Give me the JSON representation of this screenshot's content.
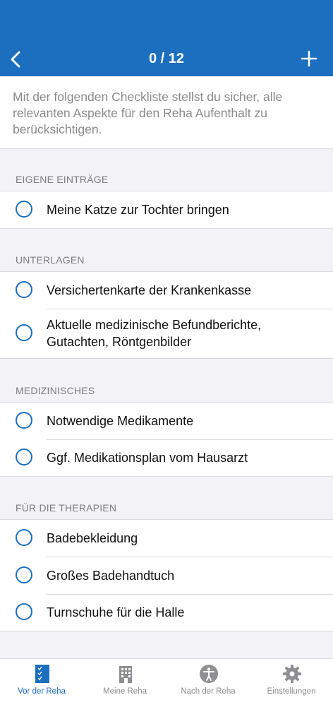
{
  "header": {
    "back_icon": "chevron-left-icon",
    "title": "0 / 12",
    "add_icon": "plus-icon",
    "background": "#1c6fbf"
  },
  "intro": {
    "text": "Mit der folgenden Checkliste stellst du sicher, alle relevanten Aspekte für den Reha Aufenthalt zu berücksichtigen."
  },
  "sections": [
    {
      "title": "EIGENE EINTRÄGE",
      "items": [
        {
          "label": "Meine Katze zur Tochter bringen",
          "checked": false
        }
      ]
    },
    {
      "title": "UNTERLAGEN",
      "items": [
        {
          "label": "Versichertenkarte der Krankenkasse",
          "checked": false
        },
        {
          "label": "Aktuelle medizinische Befundberichte, Gutachten, Röntgenbilder",
          "checked": false
        }
      ]
    },
    {
      "title": "MEDIZINISCHES",
      "items": [
        {
          "label": "Notwendige Medikamente",
          "checked": false
        },
        {
          "label": "Ggf. Medikationsplan vom Hausarzt",
          "checked": false
        }
      ]
    },
    {
      "title": "FÜR DIE THERAPIEN",
      "items": [
        {
          "label": "Badebekleidung",
          "checked": false
        },
        {
          "label": "Großes Badehandtuch",
          "checked": false
        },
        {
          "label": "Turnschuhe für die Halle",
          "checked": false
        }
      ]
    }
  ],
  "tabbar": {
    "active_color": "#1c6fbf",
    "inactive_color": "#8e8e93",
    "tabs": [
      {
        "label": "Vor der Reha",
        "icon": "checklist-icon",
        "active": true
      },
      {
        "label": "Meine Reha",
        "icon": "building-icon",
        "active": false
      },
      {
        "label": "Nach der Reha",
        "icon": "accessibility-icon",
        "active": false
      },
      {
        "label": "Einstellungen",
        "icon": "gear-icon",
        "active": false
      }
    ]
  }
}
